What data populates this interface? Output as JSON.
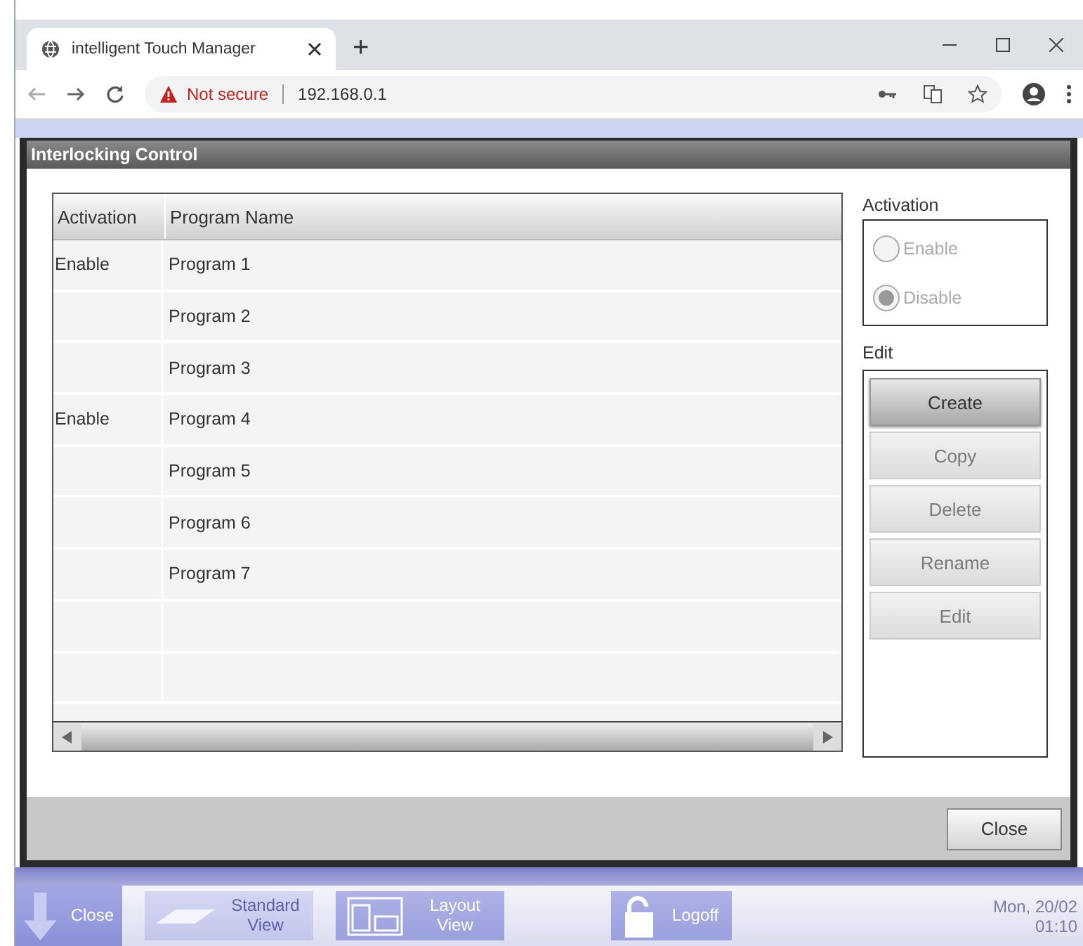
{
  "browser": {
    "tab_title": "intelligent Touch Manager",
    "new_tab": "+",
    "security": "Not secure",
    "address": "192.168.0.1"
  },
  "dialog": {
    "title": "Interlocking Control",
    "table": {
      "columns": [
        "Activation",
        "Program Name"
      ],
      "rows": [
        {
          "activation": "Enable",
          "name": "Program 1"
        },
        {
          "name": "Program 2"
        },
        {
          "name": "Program 3"
        },
        {
          "activation": "Enable",
          "name": "Program 4"
        },
        {
          "name": "Program 5"
        },
        {
          "name": "Program 6"
        },
        {
          "name": "Program 7"
        }
      ]
    },
    "activation": {
      "label": "Activation",
      "options": [
        {
          "label": "Enable",
          "selected": false,
          "disabled": true
        },
        {
          "label": "Disable",
          "selected": true,
          "disabled": true
        }
      ]
    },
    "edit": {
      "label": "Edit",
      "buttons": [
        {
          "label": "Create",
          "disabled": false
        },
        {
          "label": "Copy",
          "disabled": true
        },
        {
          "label": "Delete",
          "disabled": true
        },
        {
          "label": "Rename",
          "disabled": true
        },
        {
          "label": "Edit",
          "disabled": true
        }
      ]
    },
    "close_button": "Close"
  },
  "taskbar": {
    "items": [
      {
        "kind": "close",
        "label": "Close",
        "selected": true,
        "disabled": false
      },
      {
        "kind": "standard",
        "label": "Standard View",
        "selected": false,
        "disabled": true
      },
      {
        "kind": "layout",
        "label": "Layout View",
        "selected": false,
        "disabled": false
      },
      {
        "kind": "logoff",
        "label": "Logoff",
        "selected": false,
        "disabled": false
      }
    ],
    "date": "Mon, 20/02",
    "time": "01:10"
  }
}
